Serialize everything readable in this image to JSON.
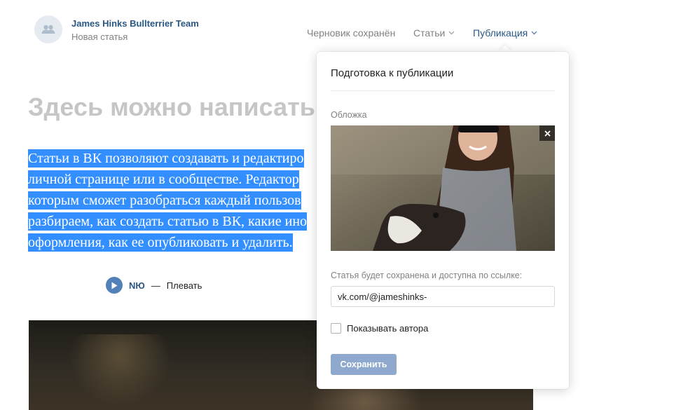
{
  "header": {
    "group_name": "James Hinks Bullterrier Team",
    "subtitle": "Новая статья",
    "nav": {
      "draft_status": "Черновик сохранён",
      "articles": "Статьи",
      "publish": "Публикация"
    }
  },
  "article": {
    "title_placeholder": "Здесь можно написать",
    "text_lines": [
      "Статьи в ВК позволяют создавать и редактиро",
      "личной странице или в сообществе. Редактор",
      "которым сможет разобраться каждый пользов",
      "разбираем, как создать статью в ВК, какие ино",
      "оформления, как ее опубликовать и удалить."
    ],
    "audio": {
      "artist": "NЮ",
      "separator": "—",
      "track": "Плевать"
    }
  },
  "publish_popup": {
    "title": "Подготовка к публикации",
    "cover_label": "Обложка",
    "close_icon": "close-icon",
    "url_label": "Статья будет сохранена и доступна по ссылке:",
    "url_value": "vk.com/@jameshinks-",
    "show_author_label": "Показывать автора",
    "show_author_checked": false,
    "save_label": "Сохранить"
  },
  "colors": {
    "link": "#2a5885",
    "selection": "#338fff",
    "button_disabled": "#8ea9cd",
    "muted": "#828282"
  }
}
